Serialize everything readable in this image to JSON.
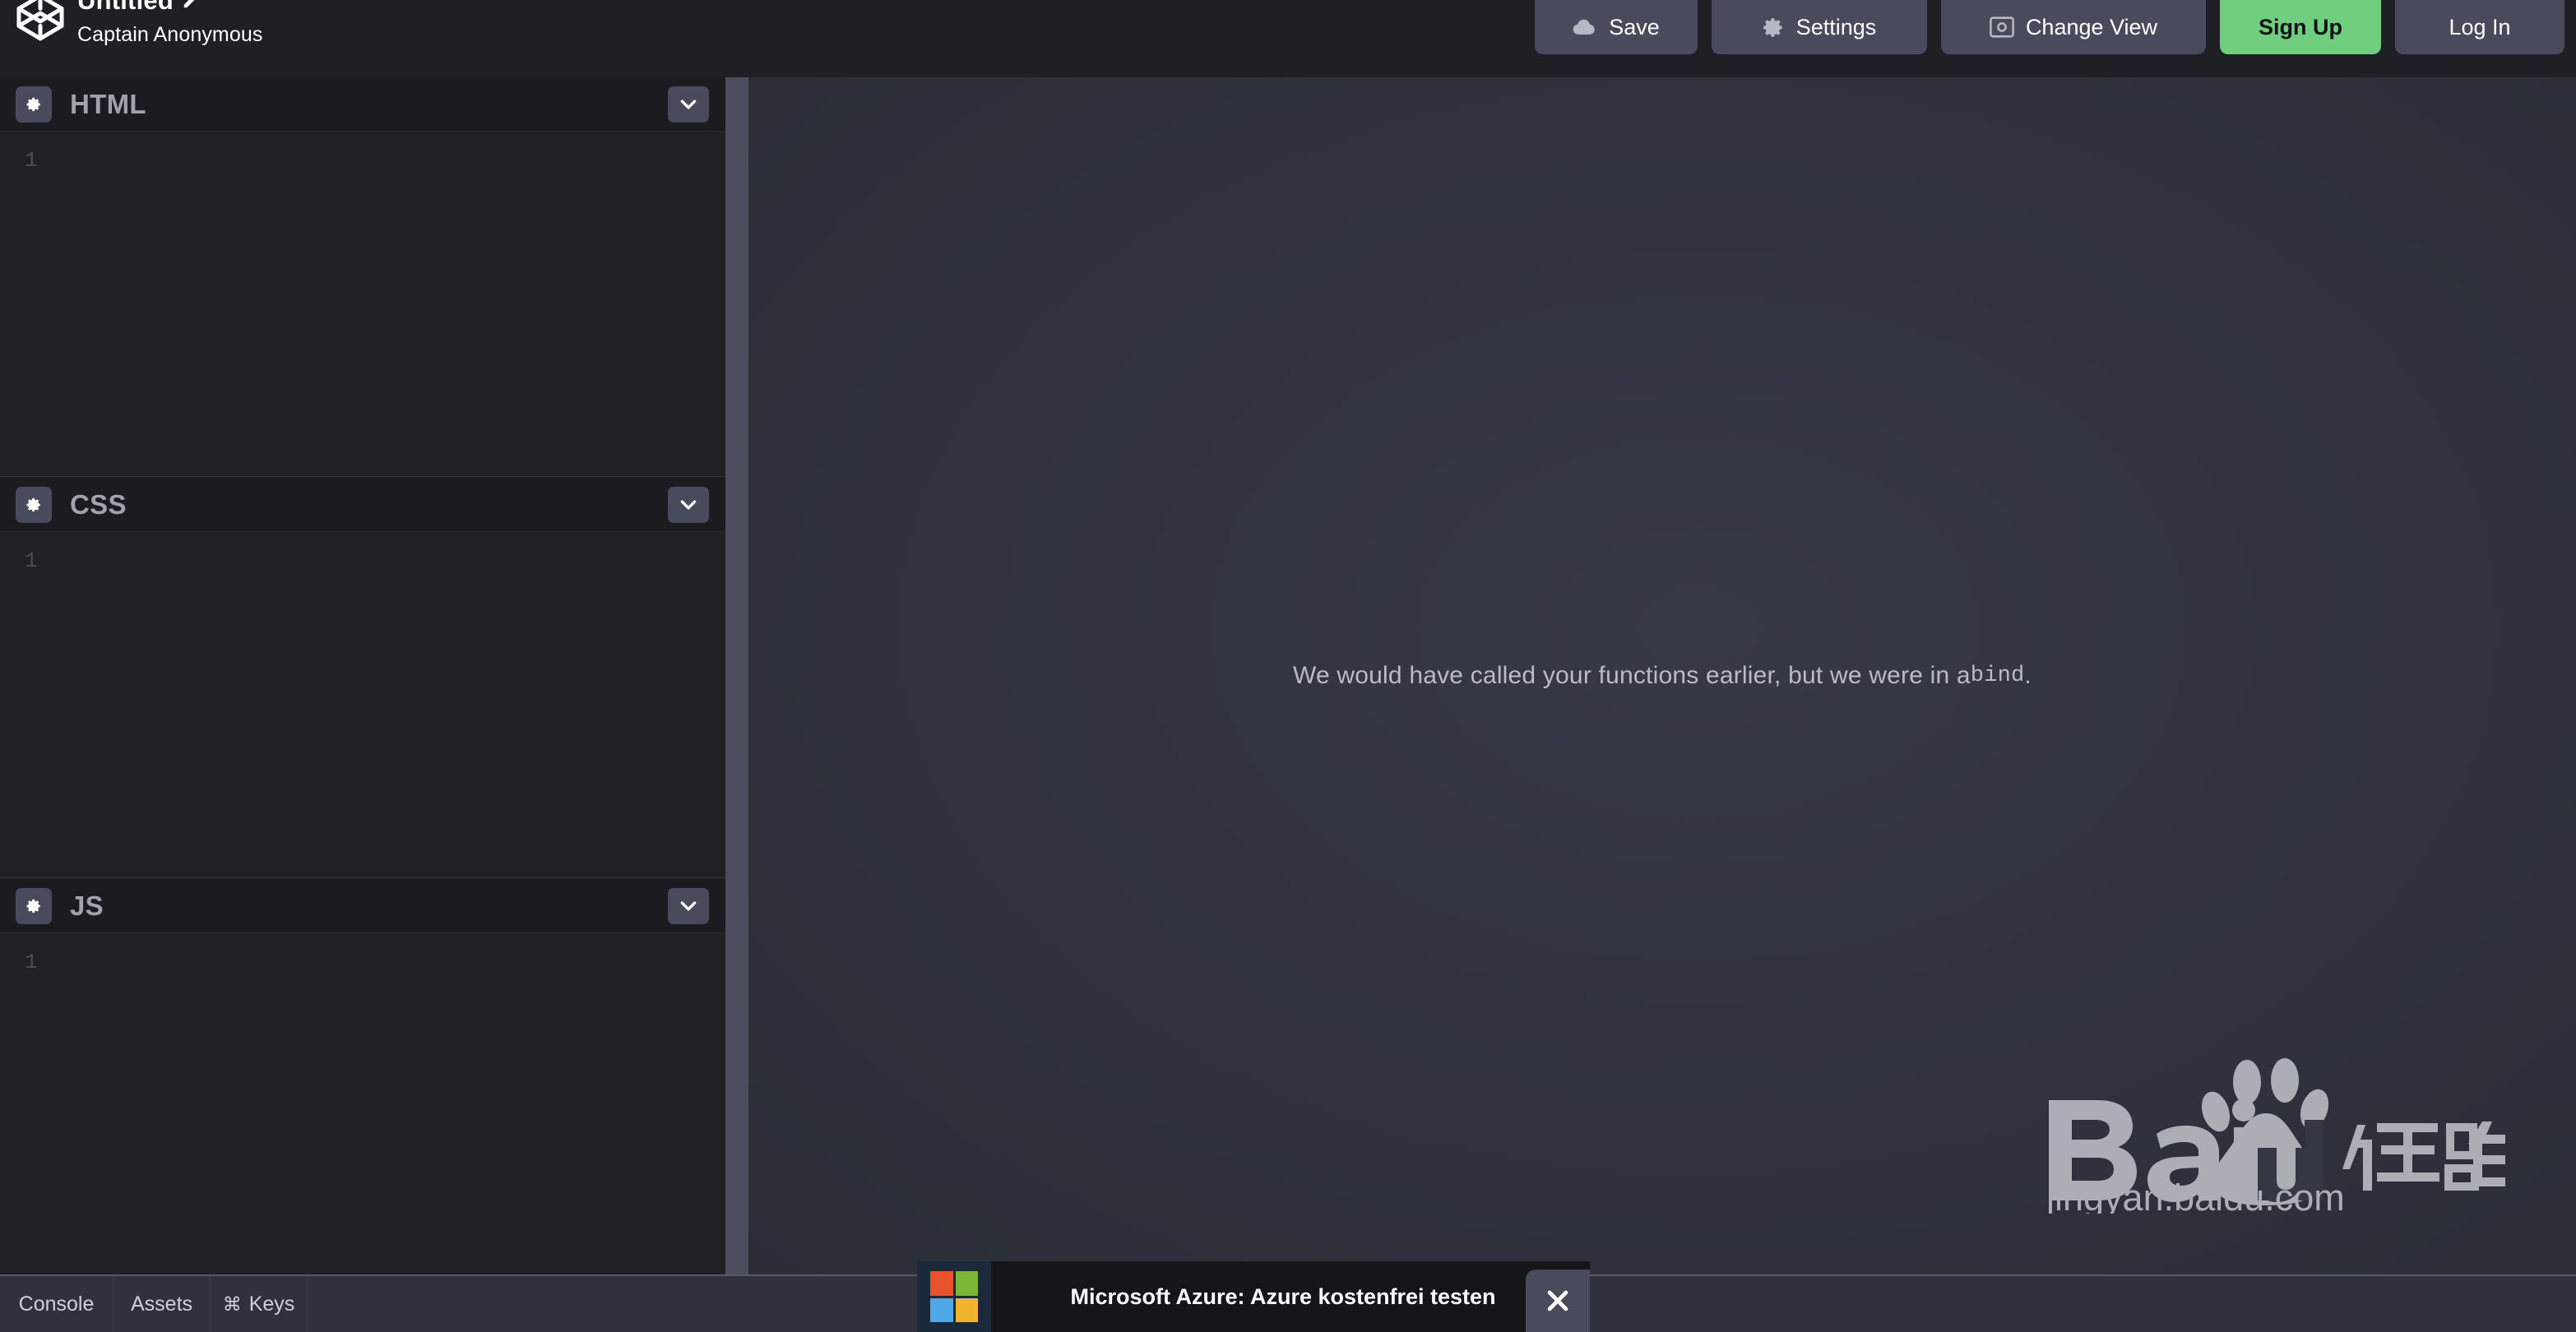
{
  "header": {
    "logo_icon": "codepen-logo-icon",
    "pen_title": "Untitled",
    "edit_icon": "pencil-edit-icon",
    "author": "Captain Anonymous",
    "buttons": [
      {
        "label": "Save",
        "icon": "cloud-save-icon",
        "key": "save"
      },
      {
        "label": "Settings",
        "icon": "gear-icon",
        "key": "settings"
      },
      {
        "label": "Change View",
        "icon": "layout-view-icon",
        "key": "changeview"
      },
      {
        "label": "Sign Up",
        "icon": "",
        "key": "signup"
      },
      {
        "label": "Log In",
        "icon": "",
        "key": "login"
      }
    ],
    "accent_green": "#6fcf7f",
    "button_bg": "#474b5b",
    "bar_bg": "#1f2025"
  },
  "editors": {
    "settings_icon": "gear-icon",
    "collapse_icon": "chevron-down-icon",
    "panes": [
      {
        "title": "HTML",
        "line_number": "1",
        "code": ""
      },
      {
        "title": "CSS",
        "line_number": "1",
        "code": ""
      },
      {
        "title": "JS",
        "line_number": "1",
        "code": ""
      }
    ],
    "pane_header_bg": "#1b1c20",
    "code_bg": "#202125"
  },
  "preview": {
    "message_text": "We would have called your functions earlier, but we were in a ",
    "message_code": "bind",
    "message_tail": ".",
    "background": "#31343f",
    "watermark": {
      "brand": "Baidu",
      "suffix": "经验",
      "url": "jingyan.baidu.com"
    }
  },
  "bottombar": {
    "items": [
      {
        "label": "Console",
        "icon": "",
        "key": "console"
      },
      {
        "label": "Assets",
        "icon": "",
        "key": "assets"
      },
      {
        "label": "Keys",
        "icon": "command-icon",
        "glyph": "⌘",
        "key": "keys"
      }
    ],
    "background": "#2f323c"
  },
  "ad": {
    "logo_icon": "microsoft-logo-icon",
    "logo_colors": [
      "#e8522a",
      "#7cb634",
      "#4fa8e8",
      "#f0b52c"
    ],
    "text": "Microsoft Azure: Azure kostenfrei testen",
    "close_icon": "close-icon",
    "close_label": "✕"
  }
}
